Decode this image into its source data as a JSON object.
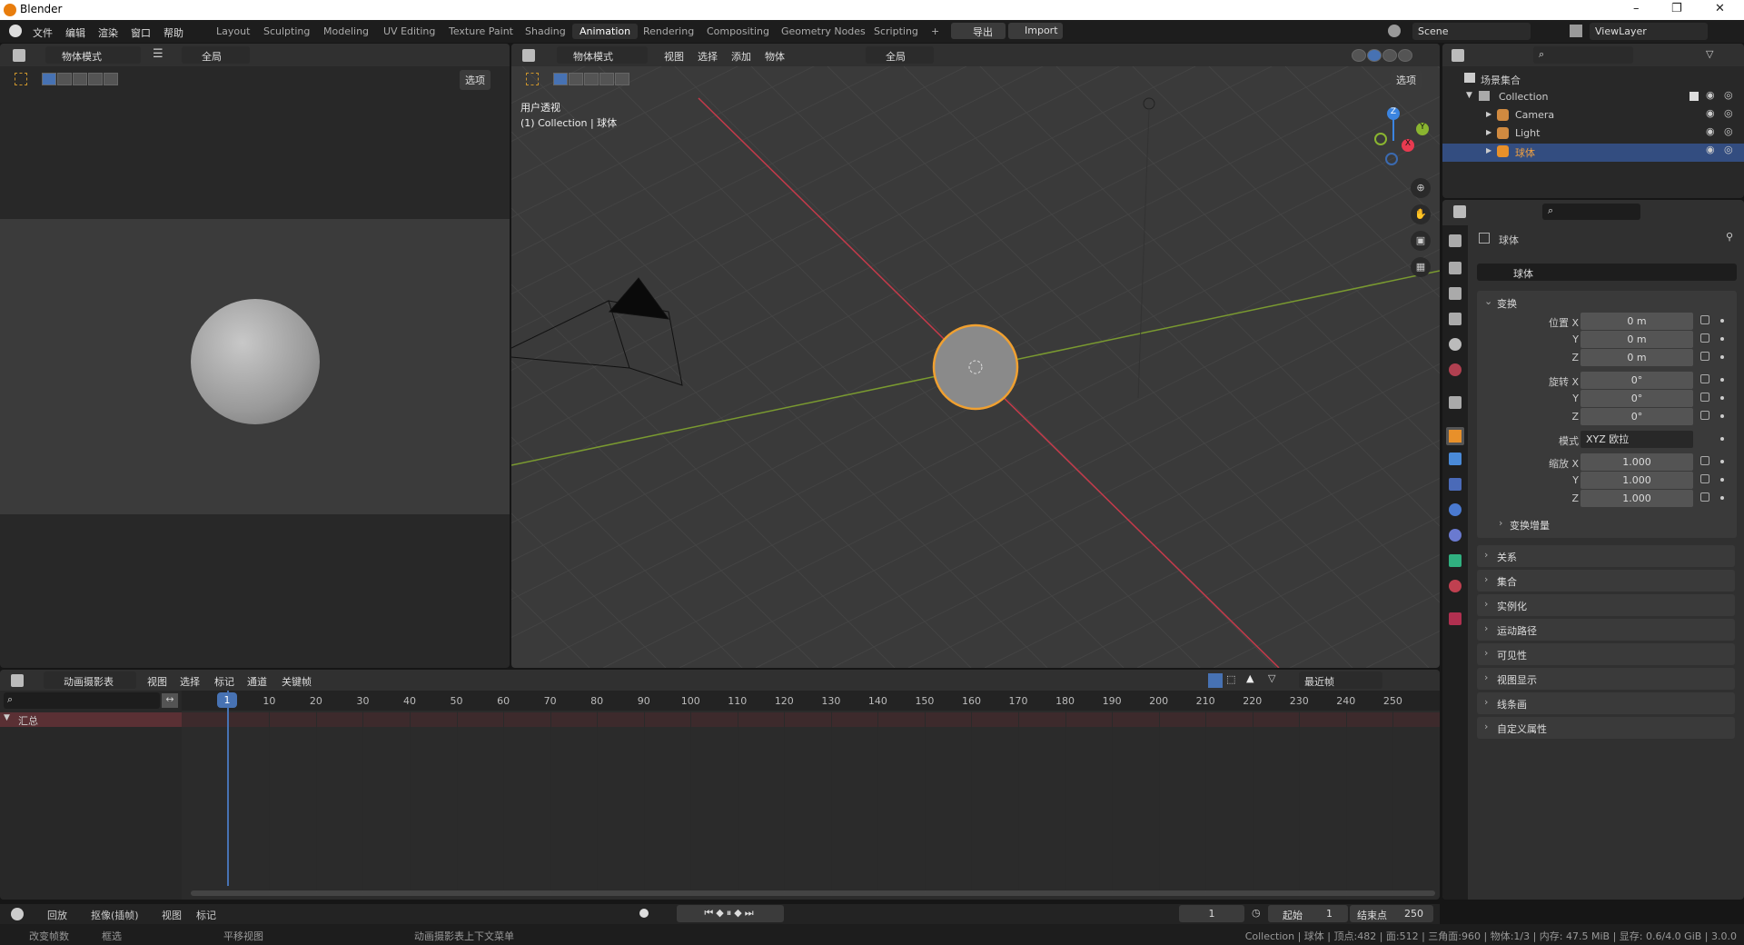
{
  "window": {
    "title": "Blender",
    "min": "–",
    "max": "❐",
    "close": "✕"
  },
  "menu": [
    "文件",
    "编辑",
    "渲染",
    "窗口",
    "帮助"
  ],
  "workspaces": [
    "Layout",
    "Sculpting",
    "Modeling",
    "UV Editing",
    "Texture Paint",
    "Shading",
    "Animation",
    "Rendering",
    "Compositing",
    "Geometry Nodes",
    "Scripting"
  ],
  "active_workspace": "Animation",
  "addon_buttons": {
    "plus": "+",
    "export": "导出",
    "import": "Import"
  },
  "scene": {
    "name": "Scene",
    "view_layer": "ViewLayer"
  },
  "left_view": {
    "mode": "物体模式",
    "transform": "全局",
    "options": "选项"
  },
  "viewport": {
    "mode": "物体模式",
    "menus": [
      "视图",
      "选择",
      "添加",
      "物体"
    ],
    "transform": "全局",
    "options": "选项",
    "overlay_title": "用户透视",
    "overlay_sub": "(1) Collection | 球体",
    "gizmo": {
      "x": "X",
      "y": "Y",
      "z": "Z"
    },
    "colors": {
      "x_axis": "#c43a4a",
      "y_axis": "#7a9a30",
      "selected": "#f0a030"
    }
  },
  "outliner": {
    "root": "场景集合",
    "collection": "Collection",
    "items": [
      {
        "name": "Camera",
        "selected": false
      },
      {
        "name": "Light",
        "selected": false
      },
      {
        "name": "球体",
        "selected": true
      }
    ]
  },
  "properties": {
    "object_name": "球体",
    "datablock": "球体",
    "transform_title": "变换",
    "location": {
      "label": "位置 X",
      "x": "0 m",
      "y": "0 m",
      "z": "0 m"
    },
    "rotation": {
      "label": "旋转 X",
      "x": "0°",
      "y": "0°",
      "z": "0°"
    },
    "mode": {
      "label": "模式",
      "value": "XYZ 欧拉"
    },
    "scale": {
      "label": "缩放 X",
      "x": "1.000",
      "y": "1.000",
      "z": "1.000"
    },
    "axis_y": "Y",
    "axis_z": "Z",
    "delta": "变换增量",
    "panels": [
      "关系",
      "集合",
      "实例化",
      "运动路径",
      "可见性",
      "视图显示",
      "线条画",
      "自定义属性"
    ]
  },
  "dopesheet": {
    "mode": "动画摄影表",
    "menus": [
      "视图",
      "选择",
      "标记",
      "通道",
      "关键帧"
    ],
    "snap": "最近帧",
    "summary": "汇总",
    "current_frame": "1",
    "ticks": [
      10,
      20,
      30,
      40,
      50,
      60,
      70,
      80,
      90,
      100,
      110,
      120,
      130,
      140,
      150,
      160,
      170,
      180,
      190,
      200,
      210,
      220,
      230,
      240,
      250
    ]
  },
  "playback": {
    "menus": [
      "回放",
      "抠像(插帧)",
      "视图",
      "标记"
    ],
    "frame": "1",
    "start_label": "起始",
    "start": "1",
    "end_label": "结束点",
    "end": "250"
  },
  "statusbar": {
    "hints": [
      "改变帧数",
      "框选",
      "平移视图",
      "动画摄影表上下文菜单"
    ],
    "info": "Collection | 球体 | 顶点:482 | 面:512 | 三角面:960 | 物体:1/3 | 内存: 47.5 MiB | 显存: 0.6/4.0 GiB | 3.0.0"
  }
}
